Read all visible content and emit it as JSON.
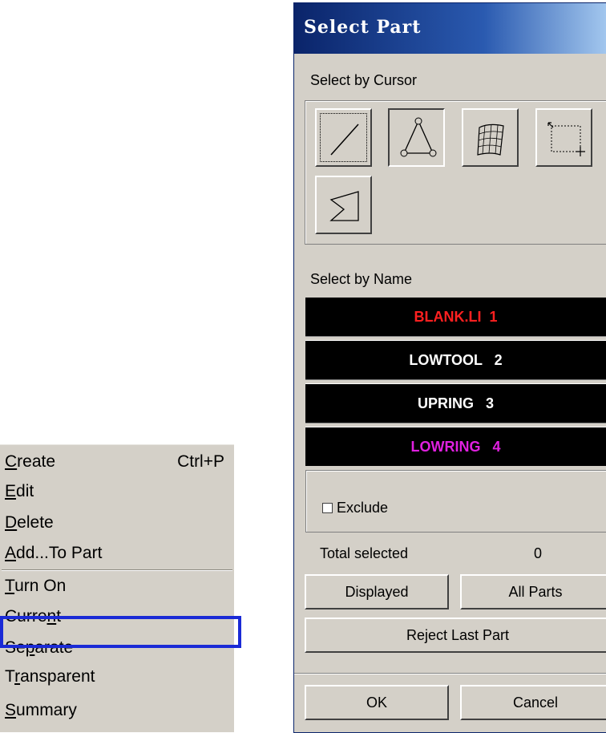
{
  "context_menu": {
    "items": [
      {
        "pre": "",
        "u": "C",
        "post": "reate",
        "shortcut": "Ctrl+P"
      },
      {
        "pre": "",
        "u": "E",
        "post": "dit",
        "shortcut": ""
      },
      {
        "pre": "",
        "u": "D",
        "post": "elete",
        "shortcut": ""
      },
      {
        "pre": "",
        "u": "A",
        "post": "dd...To Part",
        "shortcut": ""
      },
      {
        "pre": "",
        "u": "T",
        "post": "urn On",
        "shortcut": ""
      },
      {
        "pre": "Curre",
        "u": "n",
        "post": "t",
        "shortcut": ""
      },
      {
        "pre": "Se",
        "u": "p",
        "post": "arate",
        "shortcut": ""
      },
      {
        "pre": "T",
        "u": "r",
        "post": "ansparent",
        "shortcut": ""
      },
      {
        "pre": "",
        "u": "S",
        "post": "ummary",
        "shortcut": ""
      }
    ],
    "highlighted_item": "Separate",
    "highlight_color": "#1a2ad6"
  },
  "dialog": {
    "title": "Select Part",
    "select_by_cursor_label": "Select by Cursor",
    "cursor_tools": [
      {
        "icon": "line-select-icon",
        "state": "focused"
      },
      {
        "icon": "polygon-select-icon",
        "state": "pressed"
      },
      {
        "icon": "surface-select-icon",
        "state": "normal"
      },
      {
        "icon": "box-select-icon",
        "state": "normal"
      },
      {
        "icon": "area-select-icon",
        "state": "normal"
      }
    ],
    "select_by_name_label": "Select by Name",
    "parts": [
      {
        "text": "BLANK.LI  1",
        "color": "#ff2020"
      },
      {
        "text": "LOWTOOL   2",
        "color": "#ffffff"
      },
      {
        "text": "UPRING   3",
        "color": "#ffffff"
      },
      {
        "text": "LOWRING   4",
        "color": "#e020e0"
      }
    ],
    "exclude_label": "Exclude",
    "exclude_checked": false,
    "total_selected_label": "Total selected",
    "total_selected_value": "0",
    "displayed_label": "Displayed",
    "all_parts_label": "All Parts",
    "reject_last_label": "Reject Last Part",
    "ok_label": "OK",
    "cancel_label": "Cancel"
  }
}
